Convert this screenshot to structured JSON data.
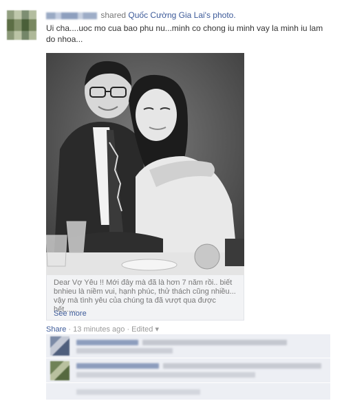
{
  "post": {
    "shared_text": "shared",
    "shared_owner": "Quốc Cường Gia Lai's photo.",
    "caption": "Ui cha....uoc mo cua bao phu nu...minh co chong iu minh vay la minh iu lam do nhoa...",
    "description": "Dear Vợ Yêu !! Mới đây mà đã là hơn 7 năm rồi.. biết bnhieu là niềm vui, hạnh phúc, thử thách cũng nhiều... vậy mà tình yêu của chúng ta đã vượt qua được hết......",
    "see_more": "See more",
    "share_label": "Share",
    "separator": "·",
    "timestamp": "13 minutes ago",
    "edited_label": "Edited",
    "chevron": "▾"
  },
  "icons": {
    "avatar": "user-avatar",
    "photo": "couple-photo"
  },
  "colors": {
    "link": "#3b5998",
    "muted": "#777777",
    "comment_bg": "#edeff4",
    "desc_bg": "#f2f3f5"
  }
}
